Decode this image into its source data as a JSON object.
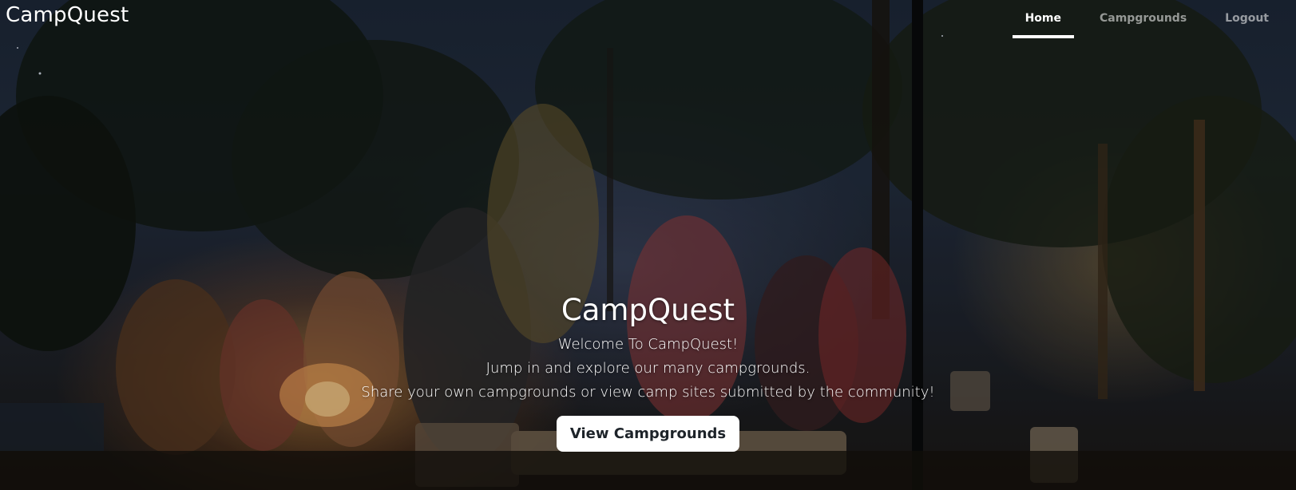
{
  "navbar": {
    "brand": "CampQuest",
    "links": [
      {
        "label": "Home",
        "active": true
      },
      {
        "label": "Campgrounds",
        "active": false
      },
      {
        "label": "Logout",
        "active": false
      }
    ]
  },
  "cover": {
    "title": "CampQuest",
    "welcome": "Welcome To CampQuest!",
    "line2": "Jump in and explore our many campgrounds.",
    "line3": "Share your own campgrounds or view camp sites submitted by the community!",
    "button_label": "View Campgrounds"
  },
  "colors": {
    "nav_active": "#ffffff",
    "nav_inactive": "rgba(255,255,255,0.55)",
    "button_bg": "#ffffff",
    "button_text": "#1d2329"
  }
}
